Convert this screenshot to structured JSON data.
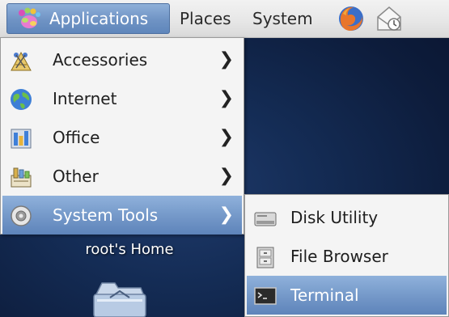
{
  "panel": {
    "applications_label": "Applications",
    "places_label": "Places",
    "system_label": "System",
    "launchers": [
      "firefox-icon",
      "mail-icon"
    ]
  },
  "applications_menu": {
    "items": [
      {
        "label": "Accessories",
        "icon": "accessories-icon",
        "has_submenu": true
      },
      {
        "label": "Internet",
        "icon": "internet-globe-icon",
        "has_submenu": true
      },
      {
        "label": "Office",
        "icon": "office-icon",
        "has_submenu": true
      },
      {
        "label": "Other",
        "icon": "other-icon",
        "has_submenu": true
      },
      {
        "label": "System Tools",
        "icon": "system-tools-icon",
        "has_submenu": true,
        "selected": true
      }
    ]
  },
  "system_tools_submenu": {
    "items": [
      {
        "label": "Disk Utility",
        "icon": "disk-utility-icon"
      },
      {
        "label": "File Browser",
        "icon": "file-browser-icon"
      },
      {
        "label": "Terminal",
        "icon": "terminal-icon",
        "selected": true
      }
    ]
  },
  "desktop": {
    "home_label": "root's Home"
  },
  "colors": {
    "selection": "#7397c8",
    "menu_bg": "#f4f4f4",
    "panel_bg": "#e6e6e6",
    "desktop_bg": "#142c55"
  }
}
